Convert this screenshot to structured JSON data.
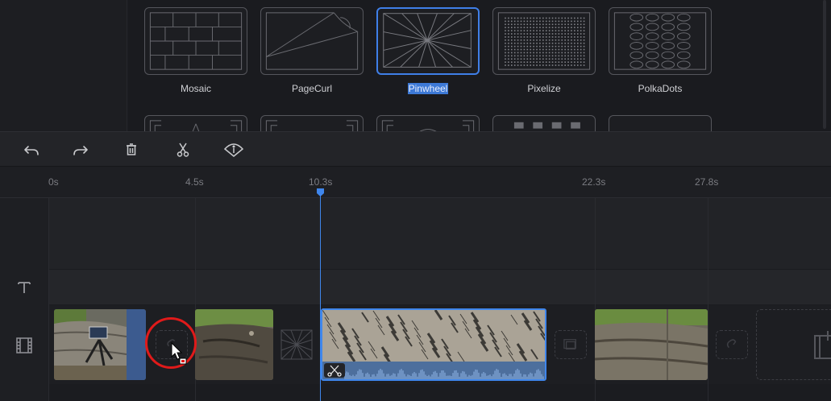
{
  "transitions": {
    "row1": [
      {
        "label": "Mosaic",
        "icon": "mosaic-grid",
        "selected": false
      },
      {
        "label": "PageCurl",
        "icon": "page-curl",
        "selected": false
      },
      {
        "label": "Pinwheel",
        "icon": "pinwheel-rays",
        "selected": true
      },
      {
        "label": "Pixelize",
        "icon": "pixel-dots",
        "selected": false
      },
      {
        "label": "PolkaDots",
        "icon": "polka-ovals",
        "selected": false
      }
    ]
  },
  "toolbar": {
    "undo": "undo-icon",
    "redo": "redo-icon",
    "delete": "trash-icon",
    "split": "scissors-icon",
    "marker": "marker-icon"
  },
  "ruler": {
    "ticks": [
      "0s",
      "4.5s",
      "10.3s",
      "22.3s",
      "27.8s"
    ]
  },
  "colors": {
    "accent": "#3f86ec",
    "selection": "#3d79d6",
    "highlight_circle": "#e01a1a"
  }
}
